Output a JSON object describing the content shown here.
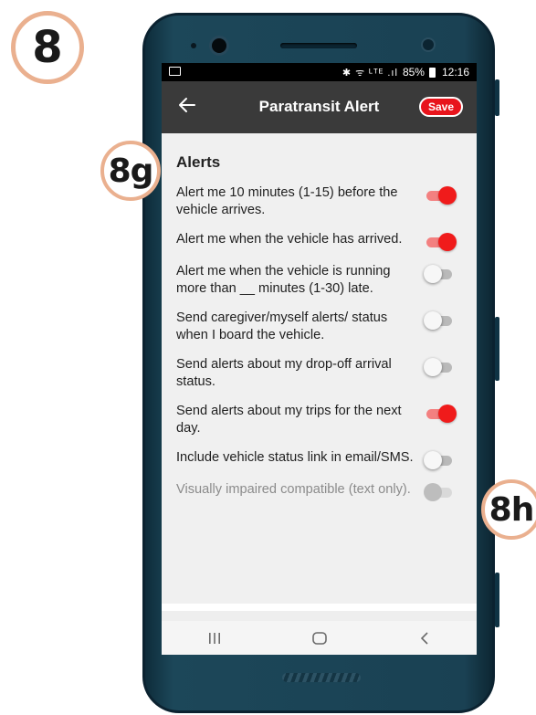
{
  "step_badge": "8",
  "callouts": {
    "g": "8g",
    "h": "8h"
  },
  "status_bar": {
    "icons": "✱ ᯤ ᴸᵀᴱ .ıl",
    "battery": "85%",
    "time": "12:16"
  },
  "app_bar": {
    "title": "Paratransit Alert",
    "save_label": "Save",
    "back_icon": "arrow-left-icon"
  },
  "section": {
    "title": "Alerts",
    "settings": [
      {
        "label": "Alert me 10 minutes (1-15) before the vehicle arrives.",
        "state": "on"
      },
      {
        "label": "Alert me when the vehicle has arrived.",
        "state": "on"
      },
      {
        "label": "Alert me when the vehicle is running more than __ minutes (1-30) late.",
        "state": "off"
      },
      {
        "label": "Send caregiver/myself alerts/ status when I board the vehicle.",
        "state": "off"
      },
      {
        "label": "Send alerts about my drop-off arrival status.",
        "state": "off"
      },
      {
        "label": "Send alerts about my trips for the next day.",
        "state": "on"
      },
      {
        "label": "Include vehicle status link in email/SMS.",
        "state": "off"
      },
      {
        "label": "Visually impaired compatible (text only).",
        "state": "disabled"
      }
    ]
  },
  "nav_bar": {
    "recents_icon": "recents-icon",
    "home_icon": "home-icon",
    "back_icon": "back-chevron-icon"
  },
  "colors": {
    "accent": "#f01b1b",
    "app_bar": "#3a3a3a",
    "callout_ring": "#eab08f",
    "phone_body": "#1c4759"
  }
}
